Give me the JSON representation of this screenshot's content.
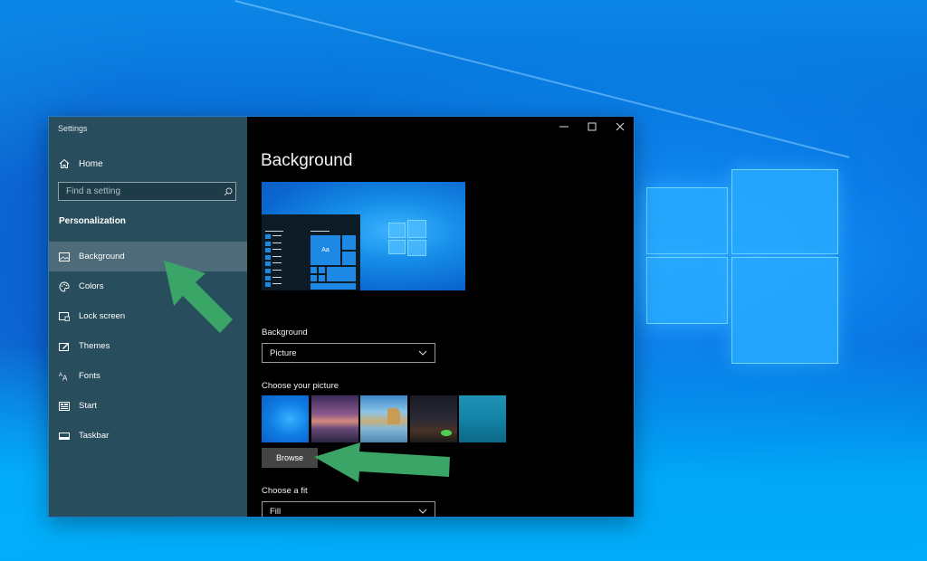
{
  "desktop": {
    "wallpaper": "windows-10-hero",
    "accent_color": "#0a78e0"
  },
  "window": {
    "app_title": "Settings",
    "caption_buttons": {
      "minimize": "minimize-icon",
      "maximize": "maximize-icon",
      "close": "close-icon"
    }
  },
  "sidebar": {
    "home_label": "Home",
    "search": {
      "placeholder": "Find a setting",
      "value": ""
    },
    "section_heading": "Personalization",
    "items": [
      {
        "label": "Background",
        "icon": "picture-icon",
        "active": true
      },
      {
        "label": "Colors",
        "icon": "palette-icon",
        "active": false
      },
      {
        "label": "Lock screen",
        "icon": "lock-screen-icon",
        "active": false
      },
      {
        "label": "Themes",
        "icon": "themes-icon",
        "active": false
      },
      {
        "label": "Fonts",
        "icon": "fonts-icon",
        "active": false
      },
      {
        "label": "Start",
        "icon": "start-icon",
        "active": false
      },
      {
        "label": "Taskbar",
        "icon": "taskbar-icon",
        "active": false
      }
    ],
    "colors": {
      "background": "#284d5c",
      "active_item": "#4d6b78"
    }
  },
  "main": {
    "page_title": "Background",
    "preview": {
      "sample_text": "Aa"
    },
    "background_field": {
      "label": "Background",
      "selected": "Picture"
    },
    "choose_picture": {
      "label": "Choose your picture",
      "thumbnails": [
        {
          "name": "windows-hero"
        },
        {
          "name": "sunset-lake"
        },
        {
          "name": "beach-rocks"
        },
        {
          "name": "night-sky"
        },
        {
          "name": "underwater-swimmer"
        }
      ],
      "browse_label": "Browse"
    },
    "fit_field": {
      "label": "Choose a fit",
      "selected": "Fill"
    }
  },
  "annotations": {
    "arrow_color": "#3aa566",
    "arrows": [
      {
        "points_to": "sidebar-item-background"
      },
      {
        "points_to": "browse-button"
      }
    ]
  }
}
